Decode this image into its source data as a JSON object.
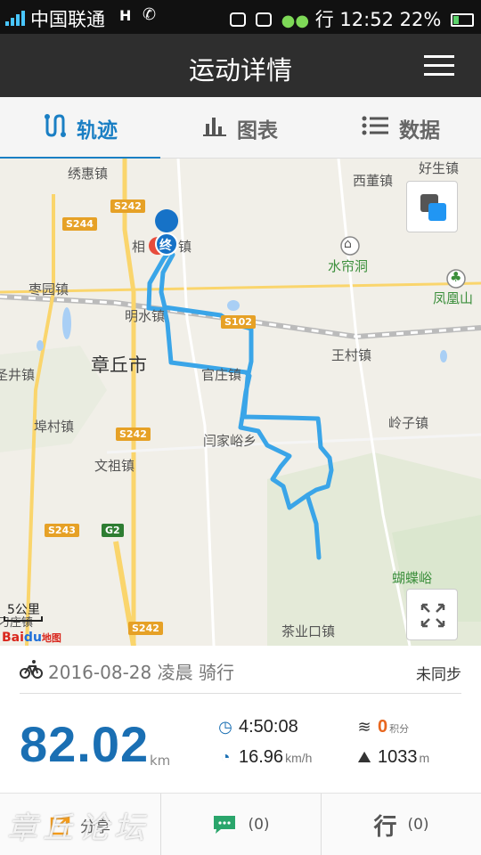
{
  "status_bar": {
    "carrier": "中国联通",
    "network": "H",
    "time": "12:52",
    "battery": "22%",
    "extra_label": "行"
  },
  "header": {
    "title": "运动详情",
    "menu_icon": "hamburger-menu-icon"
  },
  "tabs": [
    {
      "label": "轨迹",
      "icon": "track-icon",
      "active": true
    },
    {
      "label": "图表",
      "icon": "bar-chart-icon",
      "active": false
    },
    {
      "label": "数据",
      "icon": "list-icon",
      "active": false
    }
  ],
  "map": {
    "labels": {
      "xiuhui": "绣惠镇",
      "xidong": "西董镇",
      "haosheng": "好生镇",
      "xiang": "相",
      "xiang_zhen": "镇",
      "shuiliandong": "水帘洞",
      "fenghuangshan": "凤凰山",
      "zaoyuan": "枣园镇",
      "mingshui": "明水镇",
      "zhangqiu": "章丘市",
      "wangcun": "王村镇",
      "guanzhuang": "官庄镇",
      "shengjing": "圣井镇",
      "lingzi": "岭子镇",
      "zhangcun": "埠村镇",
      "yanjiayu": "闫家峪乡",
      "wenzu": "文祖镇",
      "hudieyu": "蝴蝶峪",
      "chayekou": "茶业口镇",
      "diaozhuang": "刁庄镇"
    },
    "roads": [
      "S244",
      "S242",
      "S242",
      "S243",
      "G2",
      "S242",
      "S102"
    ],
    "end_marker": "终",
    "scale": "5公里",
    "logo_brand": "Bai",
    "logo_suffix": "地图",
    "route_color": "#3aa5e8"
  },
  "summary": {
    "date_line": "2016-08-28 凌晨 骑行",
    "sync_status": "未同步",
    "distance": "82.02",
    "distance_unit": "km",
    "duration": "4:50:08",
    "points": "0",
    "points_unit": "积分",
    "speed": "16.96",
    "speed_unit": "km/h",
    "elevation": "1033",
    "elevation_unit": "m"
  },
  "bottom_bar": {
    "share_label": "分享",
    "comments": "(0)",
    "likes": "(0)",
    "like_label": "行"
  },
  "colors": {
    "accent": "#1a7fc4",
    "header_bg": "#2e2e2e",
    "distance": "#1a6fb3",
    "points": "#e8661e"
  }
}
